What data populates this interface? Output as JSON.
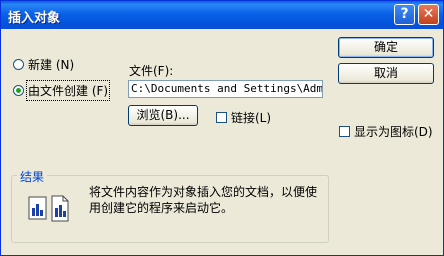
{
  "window": {
    "title": "插入对象",
    "help": "?",
    "close": "✕"
  },
  "options": {
    "new_label": "新建 (N)",
    "from_file_label": "由文件创建 (F)",
    "selected": "from_file"
  },
  "file": {
    "label": "文件(F):",
    "value": "C:\\Documents and Settings\\Admini",
    "browse_label": "浏览(B)...",
    "link_label": "链接(L)"
  },
  "buttons": {
    "ok": "确定",
    "cancel": "取消"
  },
  "display_as_icon_label": "显示为图标(D)",
  "result": {
    "title": "结果",
    "text": "将文件内容作为对象插入您的文档，以便使用创建它的程序来启动它。"
  }
}
